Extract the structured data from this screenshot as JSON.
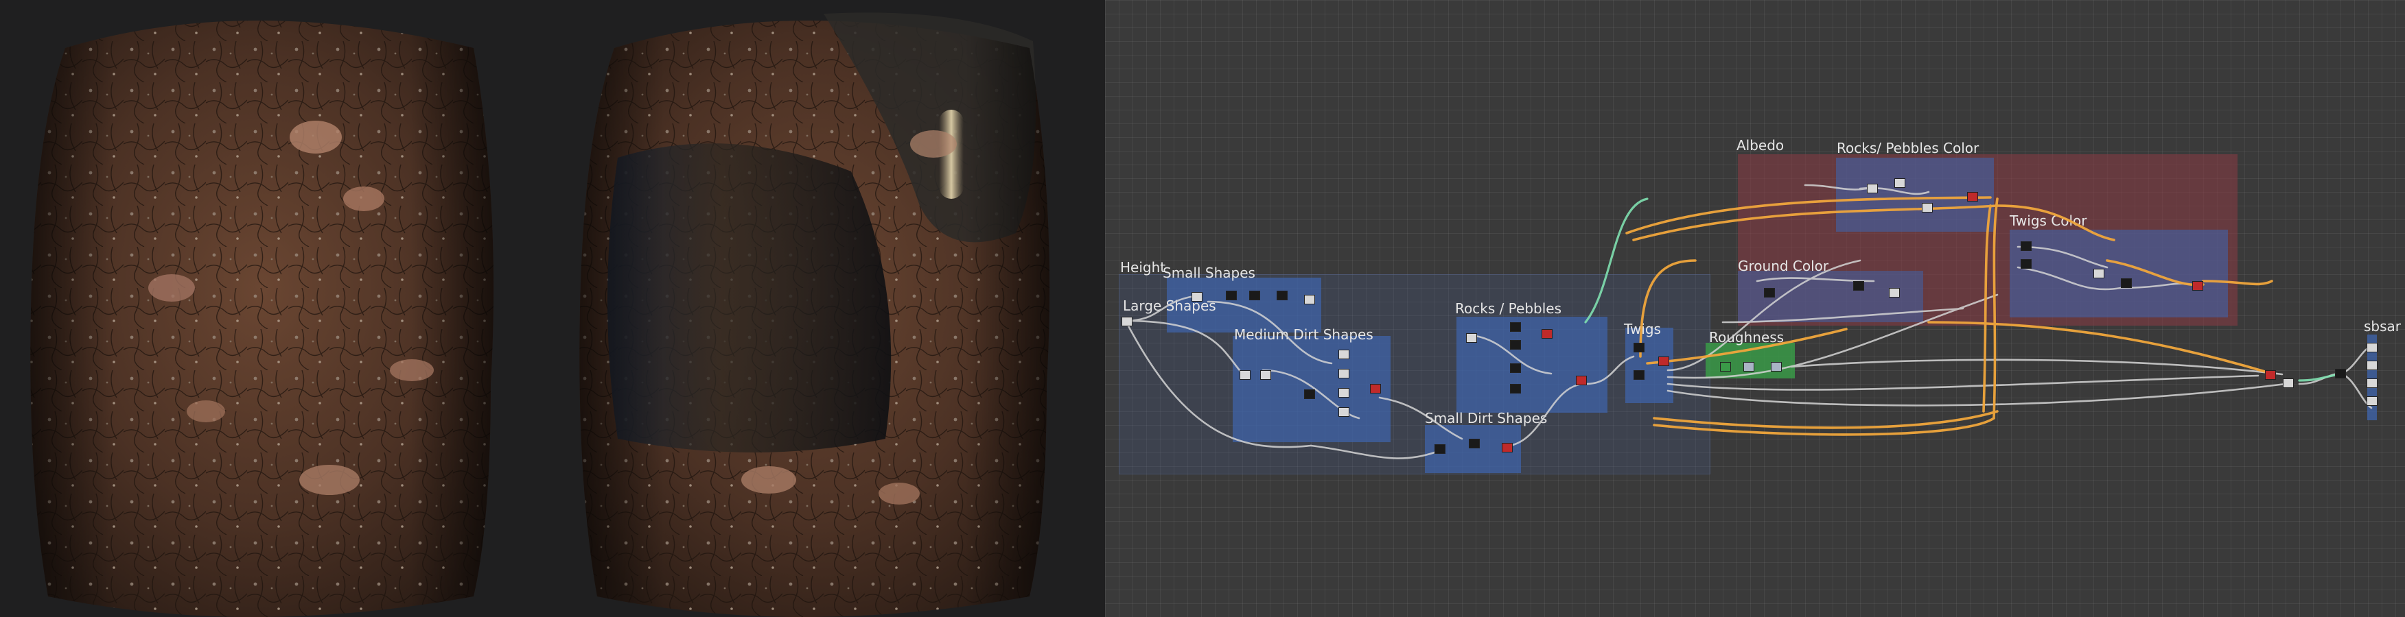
{
  "graph": {
    "frames": {
      "height": "Height",
      "small_shapes": "Small Shapes",
      "large_shapes": "Large Shapes",
      "medium_dirt_shapes": "Medium Dirt Shapes",
      "rocks_pebbles": "Rocks / Pebbles",
      "small_dirt_shapes": "Small Dirt Shapes",
      "twigs": "Twigs",
      "albedo": "Albedo",
      "rocks_pebbles_color": "Rocks/ Pebbles Color",
      "twigs_color": "Twigs Color",
      "ground_color": "Ground Color",
      "roughness": "Roughness",
      "sbsar": "sbsar"
    }
  },
  "colors": {
    "viewport_bg": "#1f1f20",
    "graph_bg": "#3a3a3a",
    "frame_blue": "#3f63a8",
    "frame_red": "#8a3a44",
    "frame_green": "#3a9a48",
    "wire_white": "#d4d4d4",
    "wire_orange": "#f0a63c",
    "wire_teal": "#7fe0b0",
    "dirt_brown": "#5a3a28"
  }
}
